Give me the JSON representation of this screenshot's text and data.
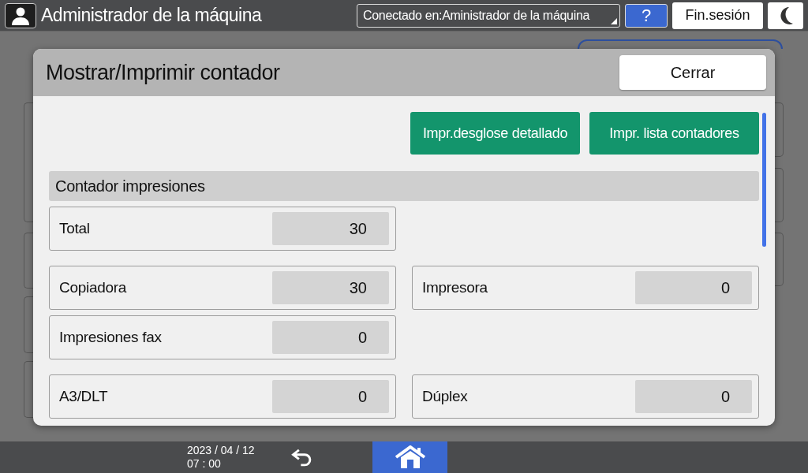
{
  "top_bar": {
    "title": "Administrador de la máquina",
    "connection": "Conectado en:Aministrador de la máquina",
    "help": "?",
    "logout": "Fin.sesión"
  },
  "dialog": {
    "title": "Mostrar/Imprimir contador",
    "close": "Cerrar",
    "actions": [
      "Impr.desglose detallado",
      "Impr. lista contadores"
    ],
    "section": "Contador impresiones",
    "groups": [
      [
        [
          {
            "label": "Total",
            "value": "30"
          }
        ]
      ],
      [
        [
          {
            "label": "Copiadora",
            "value": "30"
          },
          {
            "label": "Impresora",
            "value": "0"
          }
        ],
        [
          {
            "label": "Impresiones fax",
            "value": "0"
          }
        ]
      ],
      [
        [
          {
            "label": "A3/DLT",
            "value": "0"
          },
          {
            "label": "Dúplex",
            "value": "0"
          }
        ]
      ]
    ]
  },
  "bottom_bar": {
    "date": "2023 / 04 / 12",
    "time": "07 : 00"
  }
}
